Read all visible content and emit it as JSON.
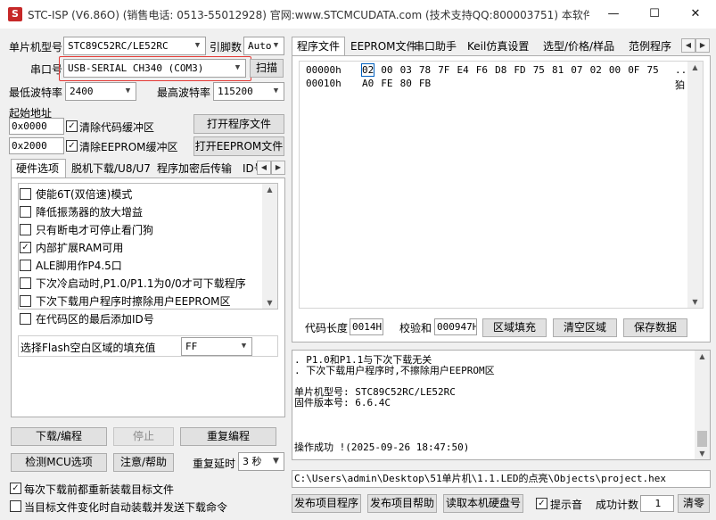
{
  "window": {
    "title": "STC-ISP (V6.86O) (销售电话: 0513-55012928) 官网:www.STCMCUDATA.com (技术支持QQ:800003751) 本软件...",
    "minimize": "—",
    "maximize": "☐",
    "close": "✕"
  },
  "left": {
    "mcu_model_label": "单片机型号",
    "mcu_model_value": "STC89C52RC/LE52RC",
    "pin_count_label": "引脚数",
    "pin_count_value": "Auto",
    "com_port_label": "串口号",
    "com_port_value": "USB-SERIAL CH340 (COM3)",
    "scan_button": "扫描",
    "min_baud_label": "最低波特率",
    "min_baud_value": "2400",
    "max_baud_label": "最高波特率",
    "max_baud_value": "115200",
    "start_addr_label": "起始地址",
    "addr1": "0x0000",
    "addr2": "0x2000",
    "clear_code_label": "清除代码缓冲区",
    "clear_eeprom_label": "清除EEPROM缓冲区",
    "open_program_button": "打开程序文件",
    "open_eeprom_button": "打开EEPROM文件",
    "tabs": [
      "硬件选项",
      "脱机下载/U8/U7",
      "程序加密后传输",
      "ID号"
    ],
    "options": [
      {
        "label": "使能6T(双倍速)模式",
        "checked": false
      },
      {
        "label": "降低振荡器的放大增益",
        "checked": false
      },
      {
        "label": "只有断电才可停止看门狗",
        "checked": false
      },
      {
        "label": "内部扩展RAM可用",
        "checked": true
      },
      {
        "label": "ALE脚用作P4.5口",
        "checked": false
      },
      {
        "label": "下次冷启动时,P1.0/P1.1为0/0才可下载程序",
        "checked": false
      },
      {
        "label": "下次下载用户程序时擦除用户EEPROM区",
        "checked": false
      },
      {
        "label": "在代码区的最后添加ID号",
        "checked": false
      }
    ],
    "flash_fill_label": "选择Flash空白区域的填充值",
    "flash_fill_value": "FF",
    "download_button": "下载/编程",
    "stop_button": "停止",
    "reprogram_button": "重复编程",
    "detect_mcu_button": "检测MCU选项",
    "help_button": "注意/帮助",
    "repeat_delay_label": "重复延时",
    "repeat_delay_value": "3 秒",
    "reload_check_label": "每次下载前都重新装载目标文件",
    "reload_checked": true,
    "auto_load_label": "当目标文件变化时自动装载并发送下载命令",
    "auto_load_checked": false
  },
  "right": {
    "tabs": [
      "程序文件",
      "EEPROM文件",
      "串口助手",
      "Keil仿真设置",
      "选型/价格/样品",
      "范例程序"
    ],
    "hex_rows": [
      {
        "addr": "00000h",
        "bytes": [
          "02",
          "00",
          "03",
          "78",
          "7F",
          "E4",
          "F6",
          "D8",
          "FD",
          "75",
          "81",
          "07",
          "02",
          "00",
          "0F",
          "75"
        ],
        "ascii": ".."
      },
      {
        "addr": "00010h",
        "bytes": [
          "A0",
          "FE",
          "80",
          "FB"
        ],
        "ascii": "狛"
      }
    ],
    "code_len_label": "代码长度",
    "code_len_value": "0014H",
    "checksum_label": "校验和",
    "checksum_value": "000947H",
    "fill_button": "区域填充",
    "clear_button": "清空区域",
    "save_button": "保存数据",
    "log_lines": [
      ". P1.0和P1.1与下次下载无关",
      ". 下次下载用户程序时,不擦除用户EEPROM区",
      "",
      "单片机型号: STC89C52RC/LE52RC",
      "固件版本号: 6.6.4C",
      "",
      "",
      "",
      "操作成功 !(2025-09-26 18:47:50)"
    ],
    "file_path": "C:\\Users\\admin\\Desktop\\51单片机\\1.1.LED的点亮\\Objects\\project.hex",
    "publish_program_button": "发布项目程序",
    "publish_help_button": "发布项目帮助",
    "read_disk_button": "读取本机硬盘号",
    "sound_label": "提示音",
    "sound_checked": true,
    "success_count_label": "成功计数",
    "success_count_value": "1",
    "clear_count_button": "清零"
  },
  "colors": {
    "highlight_red": "#e53935",
    "accent": "#0060c0"
  }
}
